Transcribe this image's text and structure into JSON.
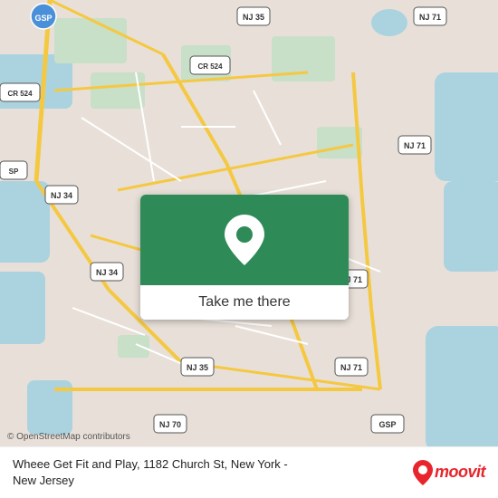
{
  "map": {
    "attribution": "© OpenStreetMap contributors",
    "center_label": "Wheee Get Fit and Play, 1182 Church St",
    "location": "New York - New Jersey"
  },
  "button": {
    "label": "Take me there",
    "bg_color": "#2e8b57"
  },
  "footer": {
    "place_name": "Wheee Get Fit and Play, 1182 Church St, New York -\nNew Jersey",
    "brand": "moovit"
  },
  "attribution": {
    "text": "© OpenStreetMap contributors"
  }
}
